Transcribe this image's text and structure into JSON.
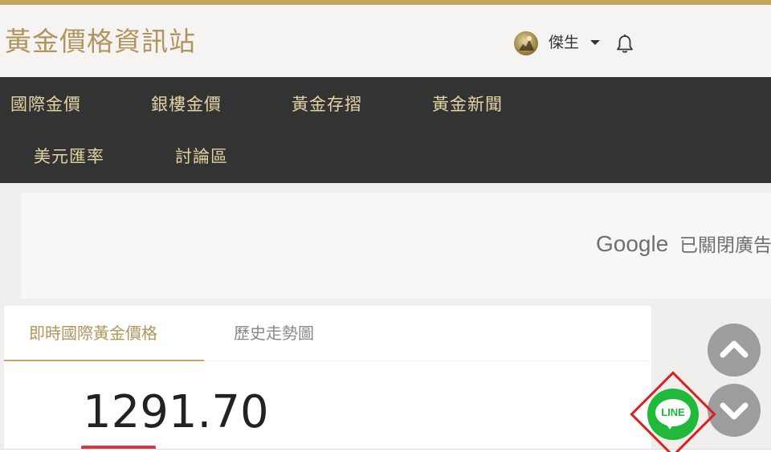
{
  "header": {
    "site_title": "黃金價格資訊站",
    "user": {
      "name": "傑生",
      "avatar_icon": "user-avatar-icon",
      "dropdown_icon": "caret-down-icon"
    },
    "notification_icon": "bell-icon"
  },
  "nav": {
    "items": [
      {
        "label": "國際金價"
      },
      {
        "label": "銀樓金價"
      },
      {
        "label": "黃金存摺"
      },
      {
        "label": "黃金新聞"
      },
      {
        "label": "美元匯率"
      },
      {
        "label": "討論區"
      }
    ]
  },
  "ad": {
    "brand": "Google",
    "status_text": "已關閉廣告"
  },
  "price_panel": {
    "tabs": [
      {
        "label": "即時國際黃金價格",
        "active": true
      },
      {
        "label": "歷史走勢圖",
        "active": false
      }
    ],
    "current_price": "1291.70"
  },
  "floating": {
    "scroll_up_icon": "chevron-up-icon",
    "scroll_down_icon": "chevron-down-icon",
    "line_label": "LINE"
  },
  "colors": {
    "brand_gold": "#b0955c",
    "nav_background": "#333333",
    "nav_text": "#e4d2a5",
    "line_green": "#20b939",
    "highlight_red": "#e0201f",
    "price_change_red": "#d9383f"
  }
}
